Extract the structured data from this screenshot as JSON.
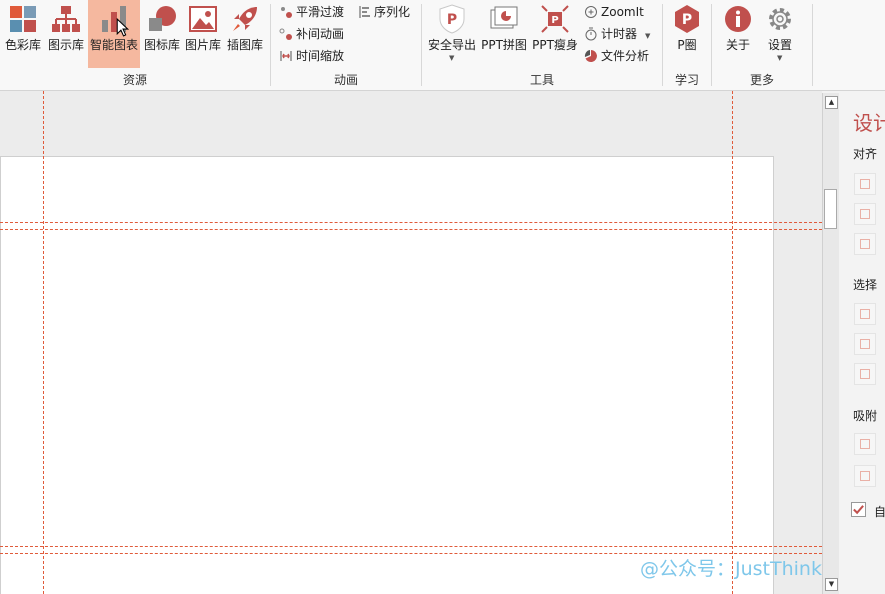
{
  "ribbon": {
    "groups": [
      {
        "label": "资源",
        "buttons": [
          {
            "label": "色彩库",
            "icon": "palette-icon"
          },
          {
            "label": "图示库",
            "icon": "org-chart-icon"
          },
          {
            "label": "智能图表",
            "icon": "bar-chart-icon",
            "state": "hovered"
          },
          {
            "label": "图标库",
            "icon": "shapes-icon"
          },
          {
            "label": "图片库",
            "icon": "picture-icon"
          },
          {
            "label": "插图库",
            "icon": "rocket-icon"
          }
        ]
      },
      {
        "label": "动画",
        "buttons": [
          {
            "label": "平滑过渡",
            "icon": "smooth-transition-icon"
          },
          {
            "label": "补间动画",
            "icon": "tween-animation-icon"
          },
          {
            "label": "时间缩放",
            "icon": "time-scale-icon"
          },
          {
            "label": "序列化",
            "icon": "sequence-icon"
          }
        ]
      },
      {
        "label": "工具",
        "buttons": [
          {
            "label": "安全导出",
            "icon": "shield-p-icon",
            "dropdown": true
          },
          {
            "label": "PPT拼图",
            "icon": "ppt-collage-icon"
          },
          {
            "label": "PPT瘦身",
            "icon": "ppt-slim-icon"
          },
          {
            "label": "ZoomIt",
            "icon": "zoom-icon"
          },
          {
            "label": "计时器",
            "icon": "timer-icon",
            "dropdown": true
          },
          {
            "label": "文件分析",
            "icon": "pie-analysis-icon"
          }
        ]
      },
      {
        "label": "学习",
        "buttons": [
          {
            "label": "P圈",
            "icon": "p-circle-icon"
          }
        ]
      },
      {
        "label": "更多",
        "buttons": [
          {
            "label": "关于",
            "icon": "info-icon"
          },
          {
            "label": "设置",
            "icon": "gear-icon",
            "dropdown": true
          }
        ]
      }
    ]
  },
  "pane": {
    "title": "设计",
    "sections": [
      "对齐",
      "选择",
      "吸附"
    ],
    "checkbox_label": "自",
    "checkbox_checked": true
  },
  "watermark": "@公众号：JustThink",
  "colors": {
    "brand_red": "#c0504d",
    "hover_bg": "#f5b89f",
    "guide": "#e05a3a",
    "watermark": "#7fc7ea"
  }
}
